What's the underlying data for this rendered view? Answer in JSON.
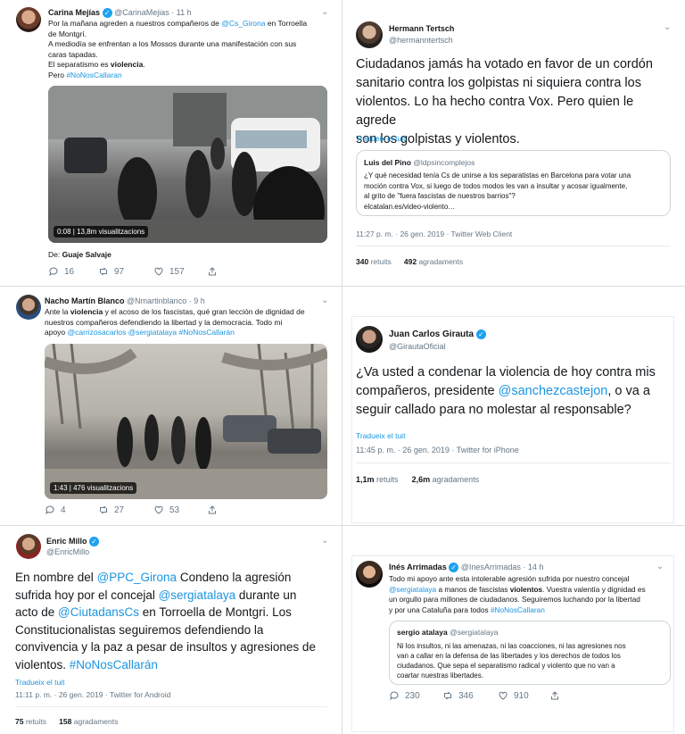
{
  "tweet1": {
    "name": "Carina Mejías",
    "handle": "@CarinaMejias",
    "time": "· 11 h",
    "line1_pre": "Por la mañana agreden a nuestros compañeros de ",
    "line1_mention": "@Cs_Girona",
    "line1_post": " en Torroella",
    "line2": "de Montgrí.",
    "line3": "A mediodía se enfrentan a los Mossos durante una manifestación con sus",
    "line4": "caras tapadas.",
    "line5_pre": "El separatismo es ",
    "line5_bold": "violencia",
    "line5_post": ".",
    "line6_pre": "Pero ",
    "line6_tag": "#NoNosCallaran",
    "video_time": "0:08",
    "video_views": "13,8m visualitzacions",
    "from_label": "De: ",
    "from_name": "Guaje Salvaje",
    "replies": "16",
    "retweets": "97",
    "likes": "157"
  },
  "tweet2": {
    "name": "Hermann Tertsch",
    "handle": "@hermanntertsch",
    "l1": "Ciudadanos jamás ha votado en favor de un cordón",
    "l2": "sanitario contra los golpistas ni siquiera contra los",
    "l3": "violentos. Lo ha hecho contra Vox. Pero quien le agrede",
    "l4": "son los golpistas y violentos.",
    "translate": "Tradueix el tuit",
    "quote_name": "Luis del Pino",
    "quote_handle": "@ldpsincomplejos",
    "quote_l1": "¿Y qué necesidad tenía Cs de unirse a los separatistas en Barcelona para votar una",
    "quote_l2": "moción contra Vox, si luego de todos modos les van a insultar y acosar igualmente,",
    "quote_l3": "al grito de \"fuera fascistas de nuestros barrios\"?",
    "quote_l4": "elcatalan.es/video-violento…",
    "timestamp": "11:27 p. m. · 26 gen. 2019 · Twitter Web Client",
    "rt_count": "340",
    "rt_label": "retuits",
    "like_count": "492",
    "like_label": "agradaments"
  },
  "tweet3": {
    "name": "Nacho Martín Blanco",
    "handle": "@Nmartinblanco",
    "time": "· 9 h",
    "l1_pre": "Ante la ",
    "l1_bold": "violencia",
    "l1_post": " y el acoso de los fascistas, qué gran lección de dignidad de",
    "l2": "nuestros compañeros defendiendo la libertad y la democracia. Todo mi",
    "l3_pre": "apoyo ",
    "l3_links": "@carrizosacarlos @sergiatalaya #NoNosCallarán",
    "video_time": "1:43",
    "video_views": "476 visualitzacions",
    "replies": "4",
    "retweets": "27",
    "likes": "53"
  },
  "tweet4": {
    "name": "Juan Carlos Girauta",
    "handle": "@GirautaOficial",
    "l1": "¿Va usted a condenar la violencia de hoy contra mis",
    "l2_pre": "compañeros, presidente ",
    "l2_mention": "@sanchezcastejon",
    "l2_post": ", o va a",
    "l3": "seguir callado para no molestar al responsable?",
    "translate": "Tradueix el tuit",
    "timestamp": "11:45 p. m. · 26 gen. 2019 · Twitter for iPhone",
    "rt_count": "1,1m",
    "rt_label": "retuits",
    "like_count": "2,6m",
    "like_label": "agradaments"
  },
  "tweet5": {
    "name": "Enric Millo",
    "handle": "@EnricMillo",
    "l1_pre": "En nombre del ",
    "l1_mention": "@PPC_Girona",
    "l1_post": "  Condeno la agresión",
    "l2_pre": "sufrida hoy por el concejal ",
    "l2_mention": "@sergiatalaya",
    "l2_post": " durante un",
    "l3_pre": "acto de ",
    "l3_mention": "@CiutadansCs",
    "l3_post": " en Torroella de Montgri. Los",
    "l4": "Constitucionalistas seguiremos defendiendo la",
    "l5": "convivencia y la paz a pesar de insultos y agresiones de",
    "l6_pre": "violentos. ",
    "l6_tag": "#NoNosCallarán",
    "translate": "Tradueix el tuit",
    "timestamp": "11:11 p. m. · 26 gen. 2019 · Twitter for Android",
    "rt_count": "75",
    "rt_label": "retuits",
    "like_count": "158",
    "like_label": "agradaments"
  },
  "tweet6": {
    "name": "Inés Arrimadas",
    "handle": "@InesArrimadas",
    "time": "· 14 h",
    "l1": "Todo mi apoyo ante esta intolerable agresión sufrida por nuestro concejal",
    "l2_mention": "@sergiatalaya",
    "l2_mid": " a manos de fascistas ",
    "l2_bold": "violentos",
    "l2_post": ". Vuestra valentía y dignidad es",
    "l3": "un orgullo para millones de ciudadanos. Seguiremos luchando por la libertad",
    "l4_pre": "y por una Cataluña para todos ",
    "l4_tag": "#NoNosCallaran",
    "quote_name": "sergio atalaya",
    "quote_handle": "@sergiatalaya",
    "quote_l1": "Ni los insultos, ni las amenazas, ni las  coacciones, ni las agresiones nos",
    "quote_l2": "van a callar en la defensa de las libertades y los derechos de todos los",
    "quote_l3": "ciudadanos. Que sepa el  separatismo radical y violento que no van a",
    "quote_l4": "coartar nuestras libertades.",
    "replies": "230",
    "retweets": "346",
    "likes": "910"
  },
  "colors": {
    "link": "#1b95e0",
    "verified": "#1da1f2",
    "muted": "#657786"
  }
}
